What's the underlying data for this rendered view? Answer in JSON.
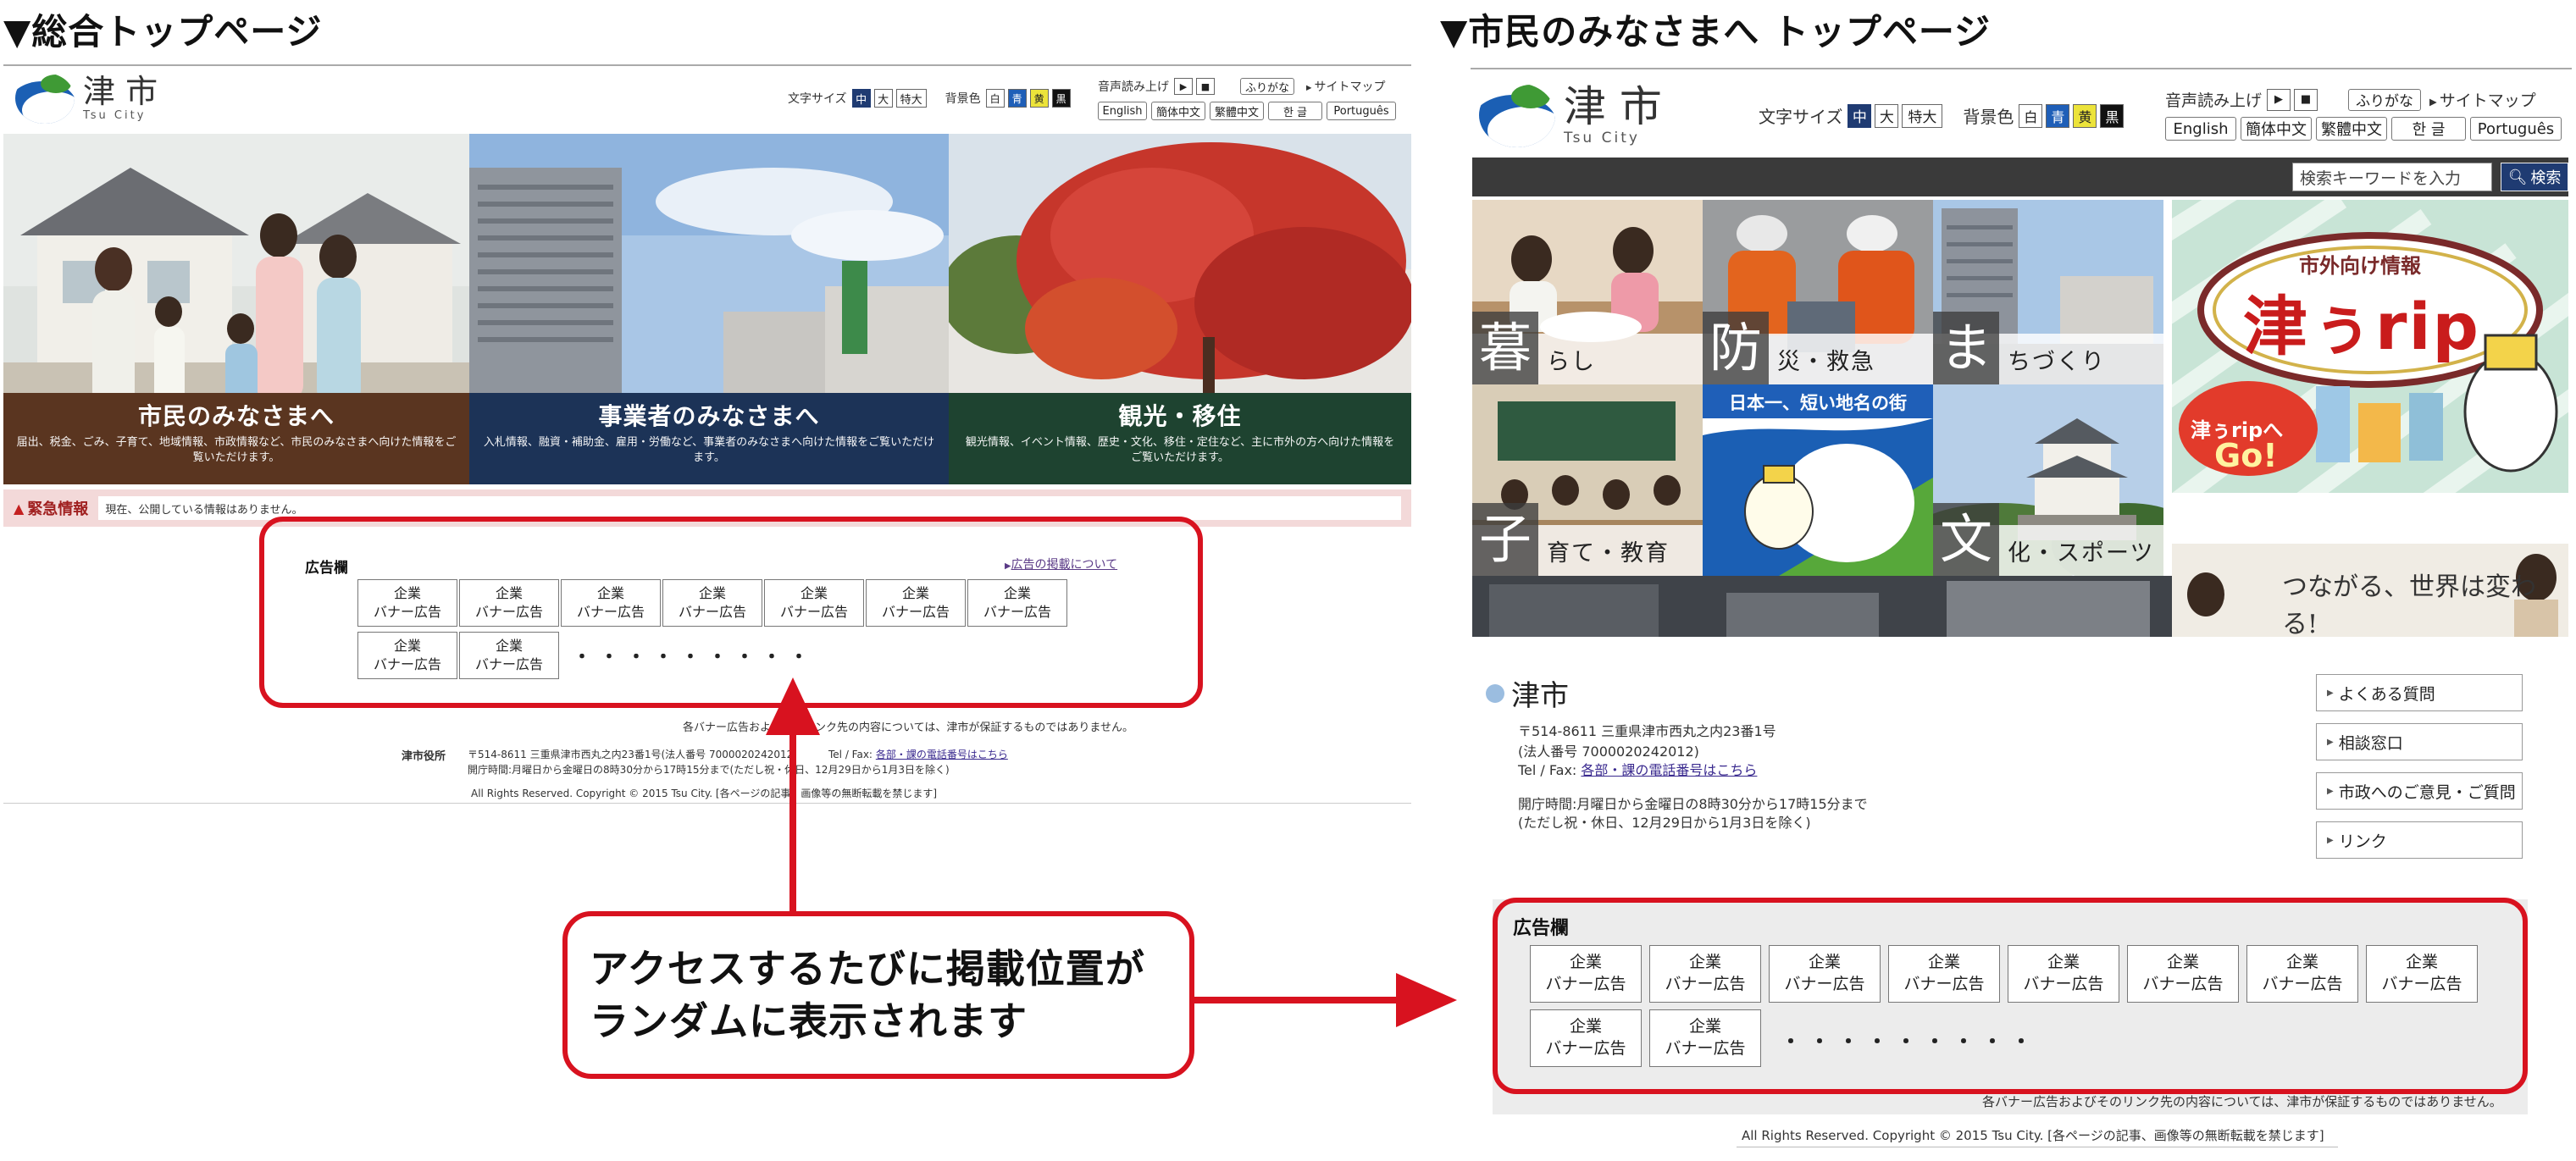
{
  "headings": {
    "left": "▼総合トップページ",
    "right": "▼市民のみなさまへ トップページ"
  },
  "logo": {
    "kanji": "津 市",
    "roman": "Tsu City"
  },
  "toolbar": {
    "font_size_label": "文字サイズ",
    "font_sizes": [
      "中",
      "大",
      "特大"
    ],
    "bg_color_label": "背景色",
    "bg_colors": [
      "白",
      "青",
      "黄",
      "黒"
    ],
    "speech_label": "音声読み上げ",
    "play": "▶",
    "stop": "■",
    "furigana": "ふりがな",
    "sitemap": "サイトマップ",
    "languages": [
      "English",
      "簡体中文",
      "繁體中文",
      "한 글",
      "Português"
    ]
  },
  "left_page": {
    "panels": [
      {
        "title": "市民のみなさまへ",
        "desc": "届出、税金、ごみ、子育て、地域情報、市政情報など、市民のみなさまへ向けた情報をご覧いただけます。"
      },
      {
        "title": "事業者のみなさまへ",
        "desc": "入札情報、融資・補助金、雇用・労働など、事業者のみなさまへ向けた情報をご覧いただけます。"
      },
      {
        "title": "観光・移住",
        "desc": "観光情報、イベント情報、歴史・文化、移住・定住など、主に市外の方へ向けた情報をご覧いただけます。"
      }
    ],
    "alert_label": "緊急情報",
    "alert_message": "現在、公開している情報はありません。",
    "ad_title": "広告欄",
    "ad_link": "広告の掲載について",
    "ad_cells": [
      [
        "企業",
        "バナー広告"
      ],
      [
        "企業",
        "バナー広告"
      ],
      [
        "企業",
        "バナー広告"
      ],
      [
        "企業",
        "バナー広告"
      ],
      [
        "企業",
        "バナー広告"
      ],
      [
        "企業",
        "バナー広告"
      ],
      [
        "企業",
        "バナー広告"
      ],
      [
        "企業",
        "バナー広告"
      ],
      [
        "企業",
        "バナー広告"
      ]
    ],
    "dots": "・・・・・・・・・",
    "disclaimer": "各バナー広告およびそのリンク先の内容については、津市が保証するものではありません。",
    "footer_org": "津市役所",
    "footer_address": "〒514-8611 三重県津市西丸之内23番1号(法人番号 7000020242012)",
    "footer_tel_label": "Tel / Fax:",
    "footer_tel_link": "各部・課の電話番号はこちら",
    "footer_hours": "開庁時間:月曜日から金曜日の8時30分から17時15分まで(ただし祝・休日、12月29日から1月3日を除く)",
    "copyright": "All Rights Reserved. Copyright © 2015 Tsu City. [各ページの記事、画像等の無断転載を禁じます]"
  },
  "callout": {
    "line1": "アクセスするたびに掲載位置が",
    "line2": "ランダムに表示されます"
  },
  "right_page": {
    "search_placeholder": "検索キーワードを入力",
    "search_button": "検索",
    "tiles": [
      {
        "big": "暮",
        "rest": "らし"
      },
      {
        "big": "防",
        "rest": "災・救急"
      },
      {
        "big": "ま",
        "rest": "ちづくり"
      },
      {
        "big": "子",
        "rest": "育て・教育"
      },
      {
        "big": "文",
        "rest": "化・スポーツ"
      }
    ],
    "badge_top": "日本一、短い地名の街",
    "promo_top": "市外向け情報",
    "promo_title": "津ぅrip",
    "promo_go1": "津ぅripへ",
    "promo_go2": "Go!",
    "promo_small": "つながる、世界は変わる!",
    "footer_name": "津市",
    "footer_address": "〒514-8611 三重県津市西丸之内23番1号",
    "footer_corp": "(法人番号 7000020242012)",
    "footer_tel_label": "Tel / Fax:",
    "footer_tel_link": "各部・課の電話番号はこちら",
    "footer_hours1": "開庁時間:月曜日から金曜日の8時30分から17時15分まで",
    "footer_hours2": "(ただし祝・休日、12月29日から1月3日を除く)",
    "side_links": [
      "よくある質問",
      "相談窓口",
      "市政へのご意見・ご質問",
      "リンク"
    ],
    "ad_title": "広告欄",
    "ad_cells": [
      [
        "企業",
        "バナー広告"
      ],
      [
        "企業",
        "バナー広告"
      ],
      [
        "企業",
        "バナー広告"
      ],
      [
        "企業",
        "バナー広告"
      ],
      [
        "企業",
        "バナー広告"
      ],
      [
        "企業",
        "バナー広告"
      ],
      [
        "企業",
        "バナー広告"
      ],
      [
        "企業",
        "バナー広告"
      ],
      [
        "企業",
        "バナー広告"
      ],
      [
        "企業",
        "バナー広告"
      ]
    ],
    "dots": "・・・・・・・・・",
    "disclaimer": "各バナー広告およびそのリンク先の内容については、津市が保証するものではありません。",
    "copyright": "All Rights Reserved. Copyright © 2015 Tsu City. [各ページの記事、画像等の無断転載を禁じます]"
  },
  "colors": {
    "accent_red": "#d8121f",
    "navy": "#1f3b72",
    "panel1_caption": "#5a3520",
    "panel2_caption": "#1c3357",
    "panel3_caption": "#1e4330"
  }
}
